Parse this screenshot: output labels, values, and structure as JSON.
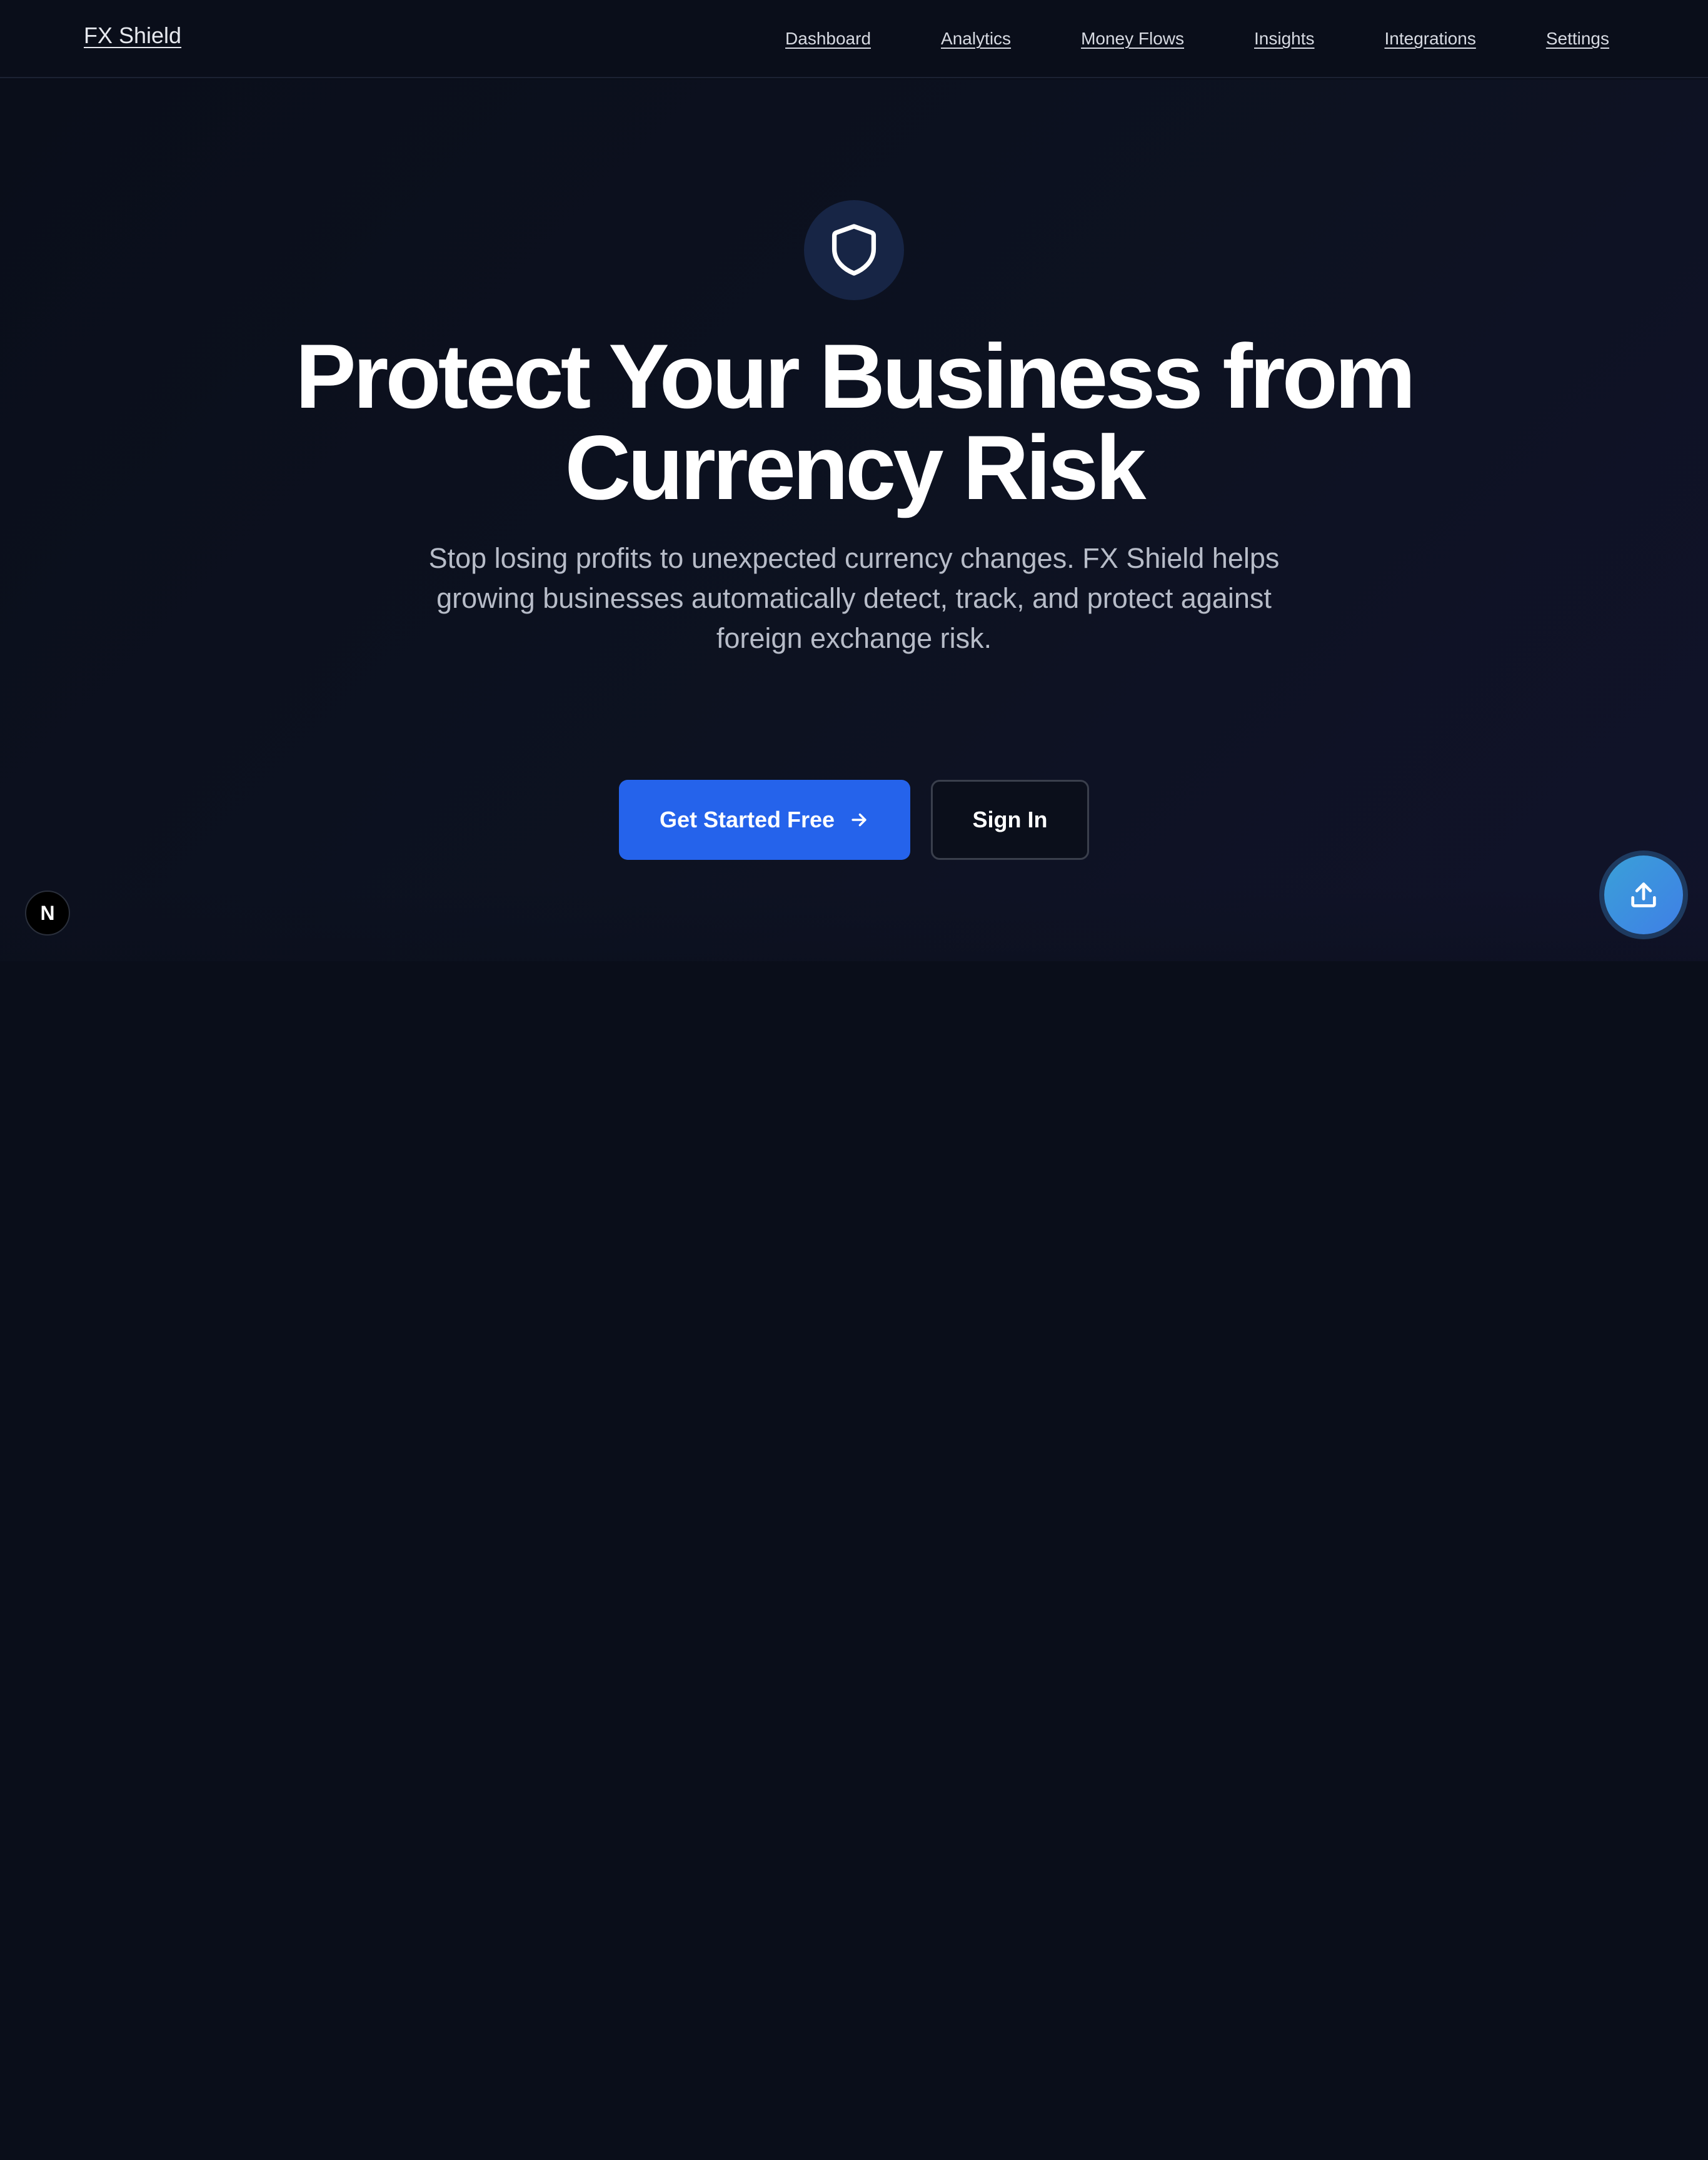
{
  "nav": {
    "brand": "FX Shield",
    "links": [
      "Dashboard",
      "Analytics",
      "Money Flows",
      "Insights",
      "Integrations",
      "Settings"
    ]
  },
  "hero": {
    "icon": "shield-icon",
    "headline_line1": "Protect Your Business from",
    "headline_line2": "Currency Risk",
    "subtext": "Stop losing profits to unexpected currency changes. FX Shield helps growing businesses automatically detect, track, and protect against foreign exchange risk.",
    "primary_button": "Get Started Free",
    "secondary_button": "Sign In"
  },
  "floating": {
    "dev_badge": "N",
    "upload_icon": "upload-icon"
  },
  "colors": {
    "background": "#0a0e1a",
    "accent": "#2563eb",
    "badge_bg": "#172545"
  }
}
